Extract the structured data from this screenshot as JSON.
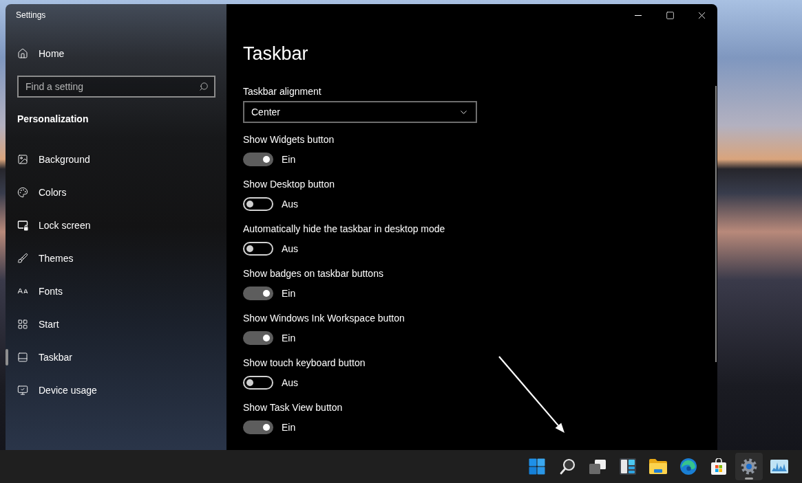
{
  "window": {
    "title": "Settings"
  },
  "sidebar": {
    "home": "Home",
    "search": {
      "placeholder": "Find a setting"
    },
    "section": "Personalization",
    "items": [
      {
        "label": "Background",
        "kind": "image",
        "selected": false
      },
      {
        "label": "Colors",
        "kind": "palette",
        "selected": false
      },
      {
        "label": "Lock screen",
        "kind": "lockscreen",
        "selected": false
      },
      {
        "label": "Themes",
        "kind": "brush",
        "selected": false
      },
      {
        "label": "Fonts",
        "kind": "fonts",
        "selected": false
      },
      {
        "label": "Start",
        "kind": "grid",
        "selected": false
      },
      {
        "label": "Taskbar",
        "kind": "taskbar",
        "selected": true
      },
      {
        "label": "Device usage",
        "kind": "device",
        "selected": false
      }
    ]
  },
  "page": {
    "title": "Taskbar",
    "alignment": {
      "label": "Taskbar alignment",
      "value": "Center"
    },
    "toggles": [
      {
        "label": "Show Widgets button",
        "on": true,
        "state_text": "Ein"
      },
      {
        "label": "Show Desktop button",
        "on": false,
        "state_text": "Aus"
      },
      {
        "label": "Automatically hide the taskbar in desktop mode",
        "on": false,
        "state_text": "Aus"
      },
      {
        "label": "Show badges on taskbar buttons",
        "on": true,
        "state_text": "Ein"
      },
      {
        "label": "Show Windows Ink Workspace button",
        "on": true,
        "state_text": "Ein"
      },
      {
        "label": "Show touch keyboard button",
        "on": false,
        "state_text": "Aus"
      },
      {
        "label": "Show Task View button",
        "on": true,
        "state_text": "Ein"
      }
    ]
  },
  "taskbar": {
    "apps": [
      {
        "kind": "start",
        "selected": false
      },
      {
        "kind": "search",
        "selected": false
      },
      {
        "kind": "taskview",
        "selected": false
      },
      {
        "kind": "widgets",
        "selected": false
      },
      {
        "kind": "explorer",
        "selected": false
      },
      {
        "kind": "browser",
        "selected": false
      },
      {
        "kind": "store",
        "selected": false
      },
      {
        "kind": "settings",
        "selected": true
      },
      {
        "kind": "monitor",
        "selected": false
      }
    ]
  }
}
